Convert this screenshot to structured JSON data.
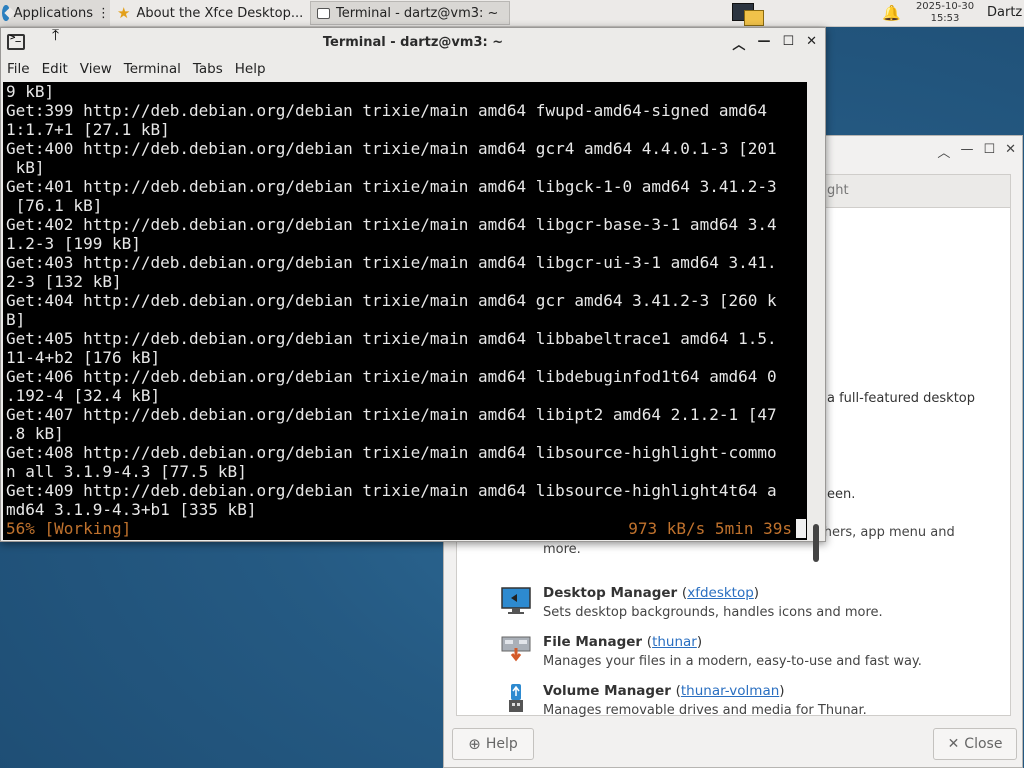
{
  "panel": {
    "applications_label": "Applications",
    "applications_suffix": "⋮",
    "tasks": [
      {
        "label": "About the Xfce Desktop..."
      },
      {
        "label": "Terminal - dartz@vm3: ~"
      }
    ],
    "clock_date": "2025-10-30",
    "clock_time": "15:53",
    "user": "Dartz"
  },
  "terminal": {
    "title": "Terminal - dartz@vm3: ~",
    "menu": [
      "File",
      "Edit",
      "View",
      "Terminal",
      "Tabs",
      "Help"
    ],
    "lines": [
      "9 kB]",
      "Get:399 http://deb.debian.org/debian trixie/main amd64 fwupd-amd64-signed amd64",
      "1:1.7+1 [27.1 kB]",
      "Get:400 http://deb.debian.org/debian trixie/main amd64 gcr4 amd64 4.4.0.1-3 [201",
      " kB]",
      "Get:401 http://deb.debian.org/debian trixie/main amd64 libgck-1-0 amd64 3.41.2-3",
      " [76.1 kB]",
      "Get:402 http://deb.debian.org/debian trixie/main amd64 libgcr-base-3-1 amd64 3.4",
      "1.2-3 [199 kB]",
      "Get:403 http://deb.debian.org/debian trixie/main amd64 libgcr-ui-3-1 amd64 3.41.",
      "2-3 [132 kB]",
      "Get:404 http://deb.debian.org/debian trixie/main amd64 gcr amd64 3.41.2-3 [260 k",
      "B]",
      "Get:405 http://deb.debian.org/debian trixie/main amd64 libbabeltrace1 amd64 1.5.",
      "11-4+b2 [176 kB]",
      "Get:406 http://deb.debian.org/debian trixie/main amd64 libdebuginfod1t64 amd64 0",
      ".192-4 [32.4 kB]",
      "Get:407 http://deb.debian.org/debian trixie/main amd64 libipt2 amd64 2.1.2-1 [47",
      ".8 kB]",
      "Get:408 http://deb.debian.org/debian trixie/main amd64 libsource-highlight-commo",
      "n all 3.1.9-4.3 [77.5 kB]",
      "Get:409 http://deb.debian.org/debian trixie/main amd64 libsource-highlight4t64 a",
      "md64 3.1.9-4.3+b1 [335 kB]"
    ],
    "status_left": "56% [Working]",
    "status_right": "973 kB/s 5min 39s"
  },
  "about": {
    "tab_fragment": "ght",
    "fragment_1": "a full-featured desktop",
    "fragment_2": "een.",
    "fragment_3_line1": "Provides a home for window buttons, launchers, app menu and",
    "fragment_3_line2": "more.",
    "components": [
      {
        "name": "Desktop Manager",
        "link": "xfdesktop",
        "desc": "Sets desktop backgrounds, handles icons and more.",
        "icon": "desktop-manager-icon"
      },
      {
        "name": "File Manager",
        "link": "thunar",
        "desc": "Manages your files in a modern, easy-to-use and fast way.",
        "icon": "file-manager-icon"
      },
      {
        "name": "Volume Manager",
        "link": "thunar-volman",
        "desc": "Manages removable drives and media for Thunar.",
        "icon": "volume-manager-icon"
      }
    ],
    "help_label": "Help",
    "close_label": "Close"
  }
}
